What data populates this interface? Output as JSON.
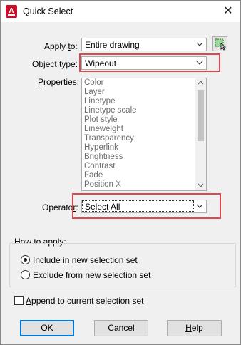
{
  "window": {
    "title": "Quick Select",
    "app_icon": "autocad-app-icon",
    "close_glyph": "✕"
  },
  "apply_to": {
    "label_pre": "Apply ",
    "label_acc": "t",
    "label_post": "o:",
    "value": "Entire drawing",
    "pick_icon": "select-objects-icon"
  },
  "object_type": {
    "label_pre": "O",
    "label_acc": "b",
    "label_post": "ject type:",
    "value": "Wipeout"
  },
  "properties": {
    "label_pre": "",
    "label_acc": "P",
    "label_post": "roperties:",
    "items": [
      "Color",
      "Layer",
      "Linetype",
      "Linetype scale",
      "Plot style",
      "Lineweight",
      "Transparency",
      "Hyperlink",
      "Brightness",
      "Contrast",
      "Fade",
      "Position X"
    ]
  },
  "operator": {
    "label_pre": "Operato",
    "label_acc": "r",
    "label_post": ":",
    "value": "Select All"
  },
  "how_to_apply": {
    "legend": "How to apply:",
    "include_pre": "",
    "include_acc": "I",
    "include_post": "nclude in new selection set",
    "include_selected": true,
    "exclude_pre": "",
    "exclude_acc": "E",
    "exclude_post": "xclude from new selection set",
    "exclude_selected": false
  },
  "append": {
    "label_pre": "",
    "label_acc": "A",
    "label_post": "ppend to current selection set",
    "checked": false
  },
  "buttons": {
    "ok": "OK",
    "cancel": "Cancel",
    "help_acc": "H",
    "help_post": "elp"
  },
  "colors": {
    "highlight_border": "#e0474c",
    "default_button_border": "#0078d7",
    "app_icon_red": "#c8102e"
  }
}
